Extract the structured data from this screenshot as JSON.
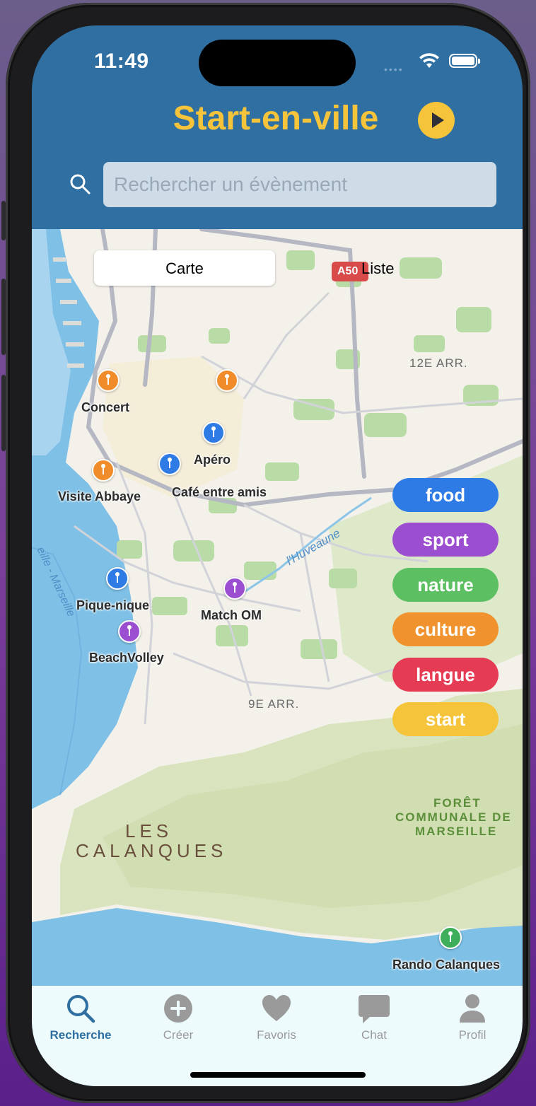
{
  "status_bar": {
    "time": "11:49"
  },
  "header": {
    "title": "Start-en-ville",
    "search_placeholder": "Rechercher un évènement"
  },
  "view_toggle": {
    "options": [
      "Carte",
      "Liste"
    ],
    "selected": "Carte"
  },
  "map": {
    "labels": {
      "arr12": "12E ARR.",
      "arr9": "9E ARR.",
      "calanques_1": "LES",
      "calanques_2": "CALANQUES",
      "foret_1": "FORÊT",
      "foret_2": "COMMUNALE DE",
      "foret_3": "MARSEILLE",
      "river": "l'Huveaune",
      "coast": "eille - Marseille",
      "road_shield": "A50"
    },
    "events": [
      {
        "name": "Concert",
        "color": "#f08c2a"
      },
      {
        "name": "Visite Abbaye",
        "color": "#f08c2a"
      },
      {
        "name": "Apéro",
        "color": "#2f7be6"
      },
      {
        "name": "Café entre amis",
        "color": "#2f7be6"
      },
      {
        "name": "Pique-nique",
        "color": "#2f7be6"
      },
      {
        "name": "Match OM",
        "color": "#9b4fd0"
      },
      {
        "name": "BeachVolley",
        "color": "#9b4fd0"
      },
      {
        "name": "Rando Calanques",
        "color": "#3fae5a"
      }
    ]
  },
  "categories": [
    {
      "label": "food",
      "color": "#2f7be6"
    },
    {
      "label": "sport",
      "color": "#9b4fd0"
    },
    {
      "label": "nature",
      "color": "#5cc063"
    },
    {
      "label": "culture",
      "color": "#f0932e"
    },
    {
      "label": "langue",
      "color": "#e63b55"
    },
    {
      "label": "start",
      "color": "#f5c43a"
    }
  ],
  "tabs": [
    {
      "label": "Recherche",
      "icon": "search-icon",
      "active": true
    },
    {
      "label": "Créer",
      "icon": "plus-circle-icon",
      "active": false
    },
    {
      "label": "Favoris",
      "icon": "heart-icon",
      "active": false
    },
    {
      "label": "Chat",
      "icon": "chat-bubble-icon",
      "active": false
    },
    {
      "label": "Profil",
      "icon": "person-icon",
      "active": false
    }
  ],
  "colors": {
    "header_bg": "#2f6fa2",
    "accent_yellow": "#f5c43a",
    "tab_active": "#2e6ea0"
  }
}
